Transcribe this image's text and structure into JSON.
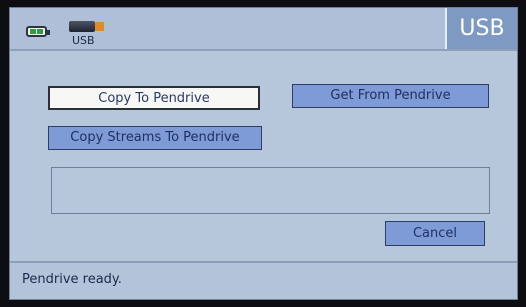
{
  "header": {
    "title": "USB",
    "usb_icon_label": "USB",
    "battery_icon": "battery-icon",
    "usb_icon": "usb-drive-icon"
  },
  "actions": {
    "copy_to_pendrive": "Copy To Pendrive",
    "get_from_pendrive": "Get From Pendrive",
    "copy_streams_to_pendrive": "Copy Streams To Pendrive",
    "cancel": "Cancel"
  },
  "message_area": {
    "value": ""
  },
  "status": {
    "text": "Pendrive ready."
  },
  "colors": {
    "background": "#b6c7dc",
    "title_box": "#7f9ac2",
    "button": "#7e9bd8",
    "selected_button": "#f7f7f5",
    "battery_level": "#2f9c3d",
    "usb_plug": "#e08a2a"
  }
}
